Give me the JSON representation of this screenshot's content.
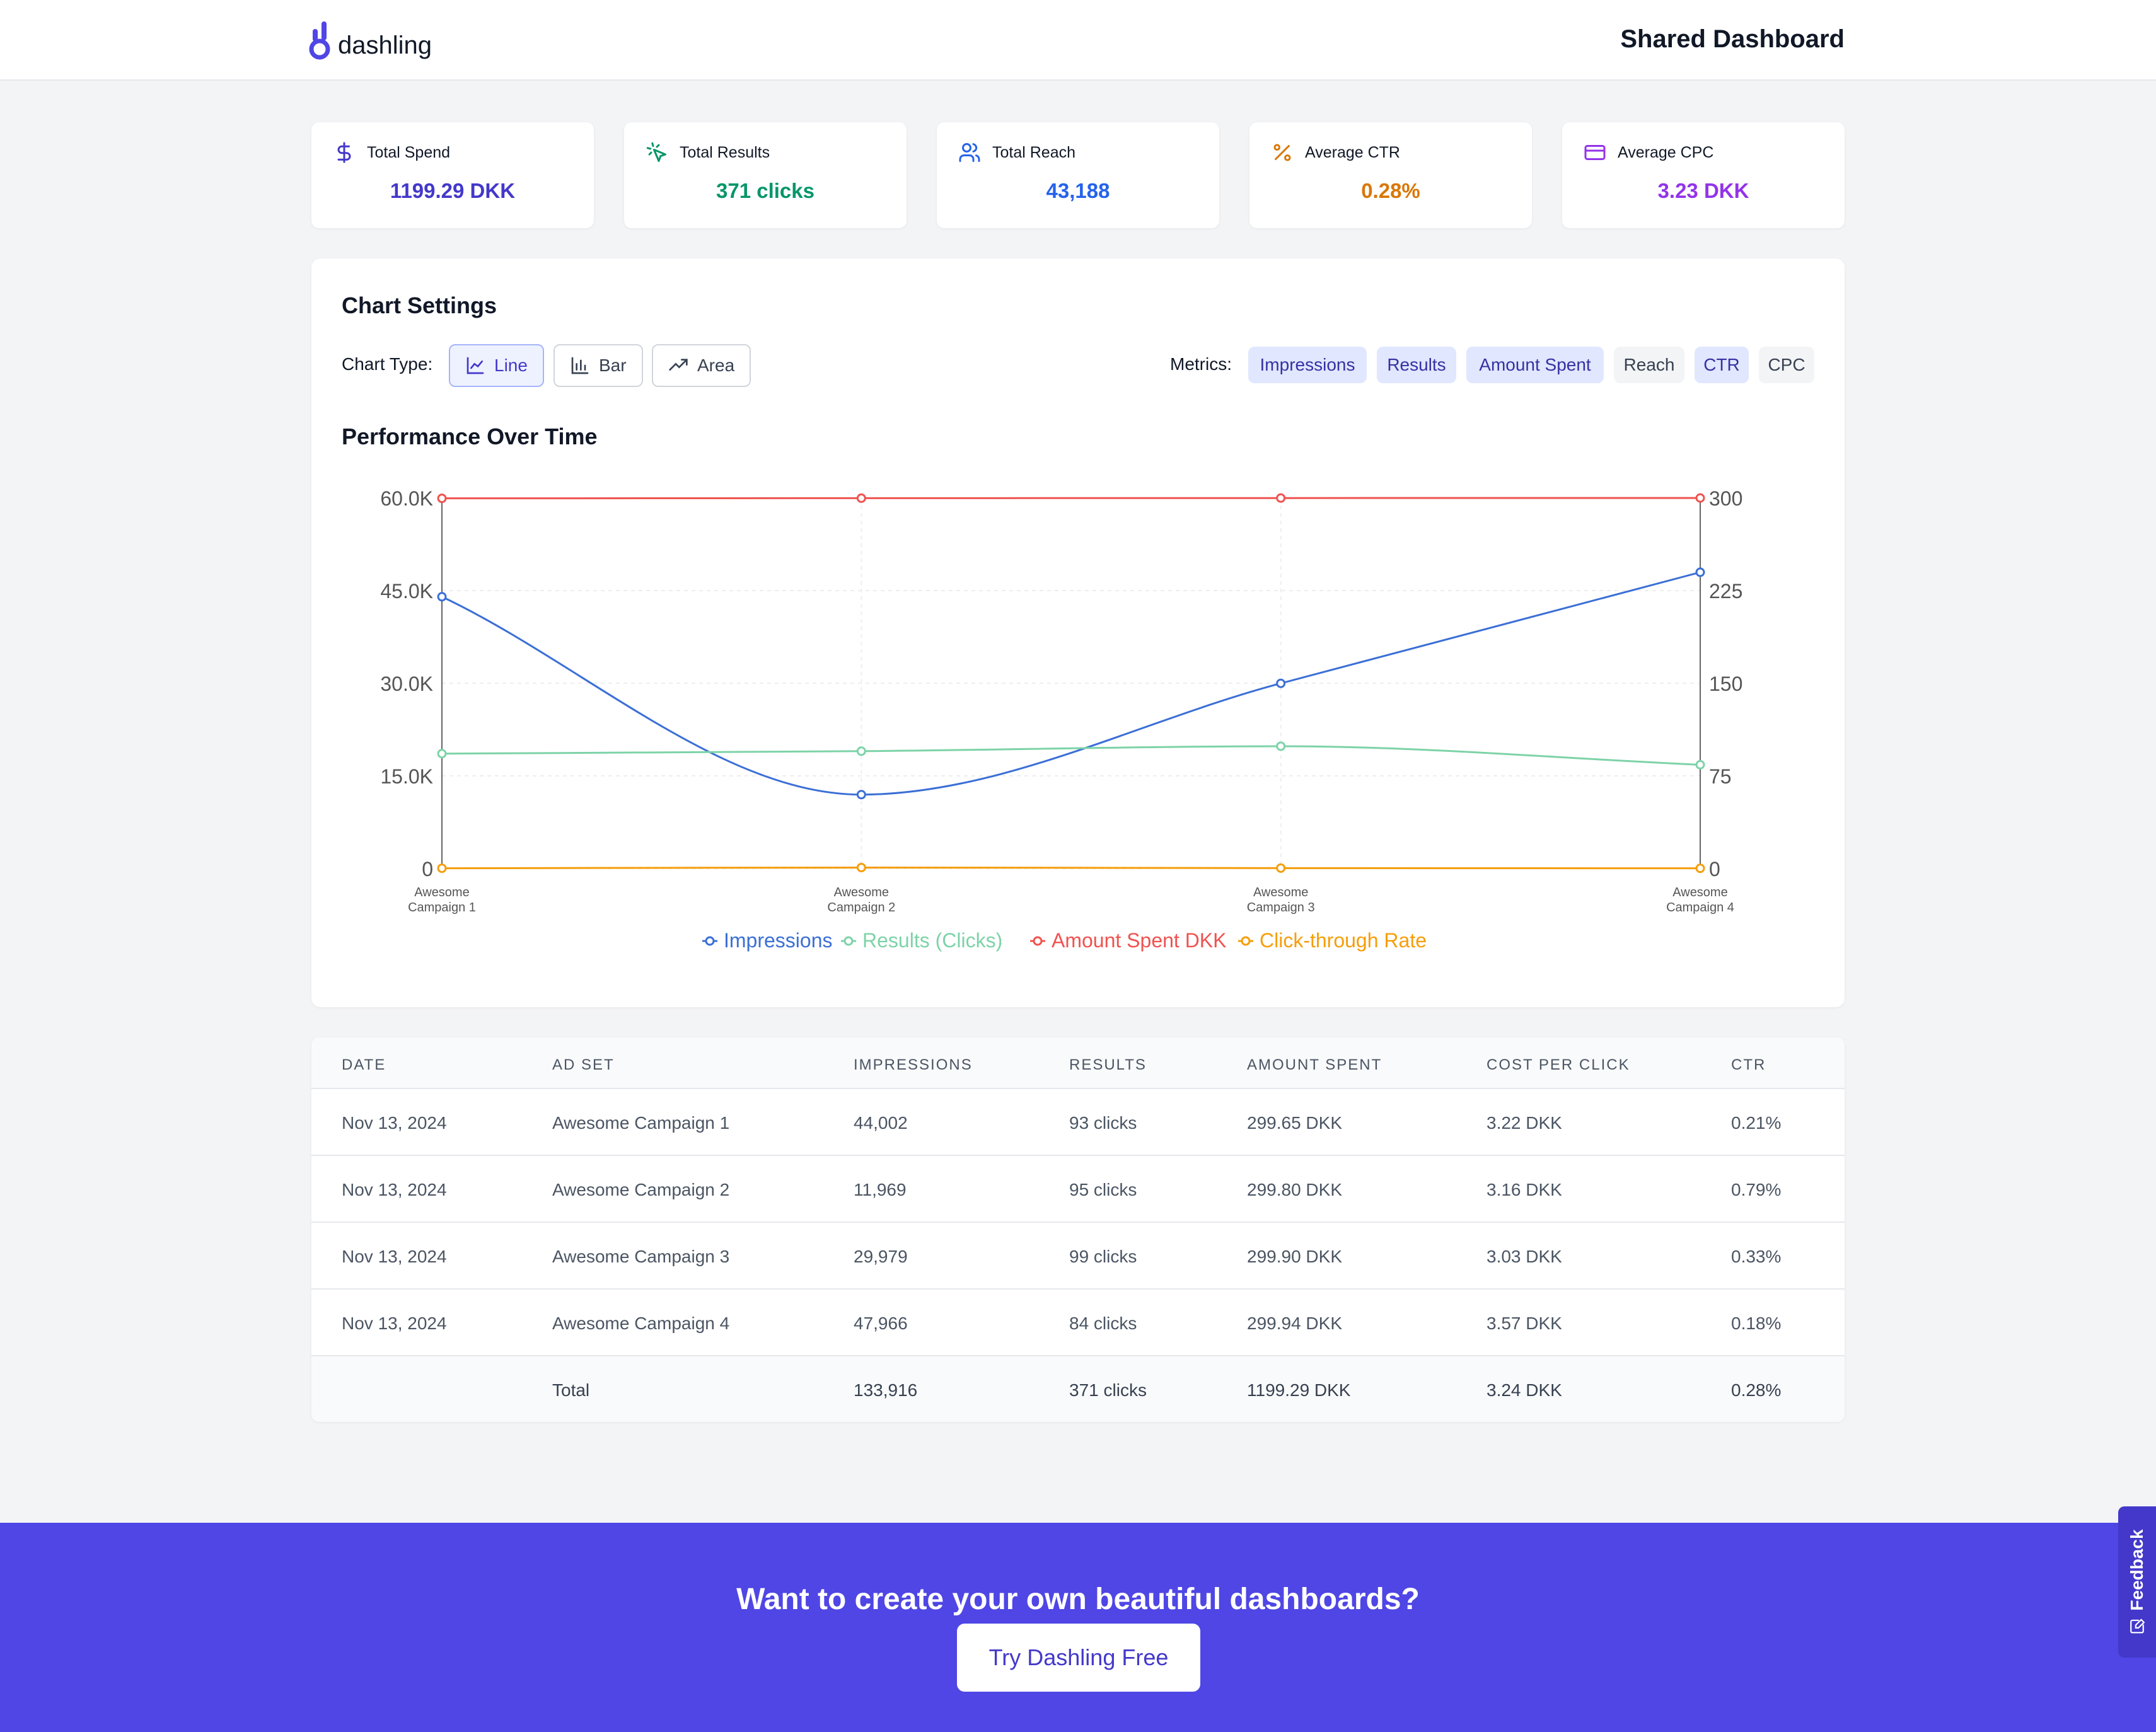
{
  "header": {
    "logo_text": "dashling",
    "title": "Shared Dashboard"
  },
  "stats": [
    {
      "label": "Total Spend",
      "value": "1199.29 DKK",
      "icon": "dollar-icon",
      "color": "#4338ca"
    },
    {
      "label": "Total Results",
      "value": "371 clicks",
      "icon": "cursor-click-icon",
      "color": "#059669"
    },
    {
      "label": "Total Reach",
      "value": "43,188",
      "icon": "users-icon",
      "color": "#2563eb"
    },
    {
      "label": "Average CTR",
      "value": "0.28%",
      "icon": "percent-icon",
      "color": "#d97706"
    },
    {
      "label": "Average CPC",
      "value": "3.23 DKK",
      "icon": "credit-card-icon",
      "color": "#9333ea"
    }
  ],
  "chart_settings": {
    "title": "Chart Settings",
    "chart_type_label": "Chart Type:",
    "types": [
      {
        "label": "Line",
        "icon": "line-chart-icon",
        "active": true
      },
      {
        "label": "Bar",
        "icon": "bar-chart-icon",
        "active": false
      },
      {
        "label": "Area",
        "icon": "trending-up-icon",
        "active": false
      }
    ],
    "metrics_label": "Metrics:",
    "metrics": [
      {
        "label": "Impressions",
        "active": true
      },
      {
        "label": "Results",
        "active": true
      },
      {
        "label": "Amount Spent",
        "active": true
      },
      {
        "label": "Reach",
        "active": false
      },
      {
        "label": "CTR",
        "active": true
      },
      {
        "label": "CPC",
        "active": false
      }
    ]
  },
  "chart_data": {
    "type": "line",
    "title": "Performance Over Time",
    "categories": [
      "Awesome Campaign 1",
      "Awesome Campaign 2",
      "Awesome Campaign 3",
      "Awesome Campaign 4"
    ],
    "y_left": {
      "ticks": [
        "0",
        "15.0K",
        "30.0K",
        "45.0K",
        "60.0K"
      ],
      "range": [
        0,
        60000
      ]
    },
    "y_right": {
      "ticks": [
        "0",
        "75",
        "150",
        "225",
        "300"
      ],
      "range": [
        0,
        300
      ]
    },
    "grid": true,
    "legend_position": "bottom",
    "series": [
      {
        "name": "Impressions",
        "values": [
          44002,
          11969,
          29979,
          47966
        ],
        "axis": "left",
        "color": "#3b6fd6"
      },
      {
        "name": "Results (Clicks)",
        "values": [
          93,
          95,
          99,
          84
        ],
        "axis": "right",
        "color": "#7dd3a8"
      },
      {
        "name": "Amount Spent DKK",
        "values": [
          299.65,
          299.8,
          299.9,
          299.94
        ],
        "axis": "right",
        "color": "#ef5350"
      },
      {
        "name": "Click-through Rate",
        "values": [
          0.21,
          0.79,
          0.33,
          0.18
        ],
        "axis": "right",
        "color": "#f59e0b"
      }
    ]
  },
  "table": {
    "columns": [
      "DATE",
      "AD SET",
      "IMPRESSIONS",
      "RESULTS",
      "AMOUNT SPENT",
      "COST PER CLICK",
      "CTR"
    ],
    "rows": [
      [
        "Nov 13, 2024",
        "Awesome Campaign 1",
        "44,002",
        "93 clicks",
        "299.65 DKK",
        "3.22 DKK",
        "0.21%"
      ],
      [
        "Nov 13, 2024",
        "Awesome Campaign 2",
        "11,969",
        "95 clicks",
        "299.80 DKK",
        "3.16 DKK",
        "0.79%"
      ],
      [
        "Nov 13, 2024",
        "Awesome Campaign 3",
        "29,979",
        "99 clicks",
        "299.90 DKK",
        "3.03 DKK",
        "0.33%"
      ],
      [
        "Nov 13, 2024",
        "Awesome Campaign 4",
        "47,966",
        "84 clicks",
        "299.94 DKK",
        "3.57 DKK",
        "0.18%"
      ]
    ],
    "total": [
      "",
      "Total",
      "133,916",
      "371 clicks",
      "1199.29 DKK",
      "3.24 DKK",
      "0.28%"
    ]
  },
  "cta": {
    "title": "Want to create your own beautiful dashboards?",
    "button": "Try Dashling Free"
  },
  "feedback": {
    "label": "Feedback",
    "icon": "edit-icon"
  }
}
